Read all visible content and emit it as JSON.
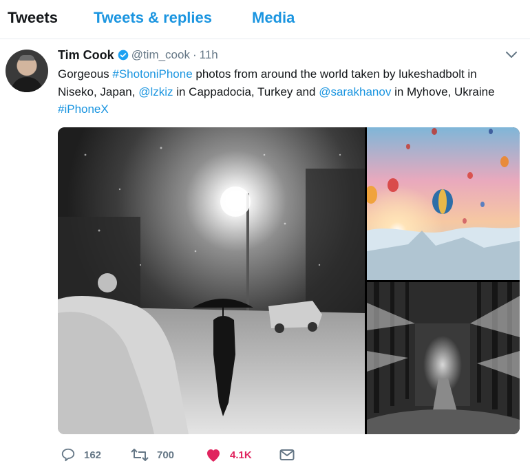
{
  "tabs": [
    "Tweets",
    "Tweets & replies",
    "Media"
  ],
  "tweet": {
    "name": "Tim Cook",
    "handle": "@tim_cook",
    "separator": "·",
    "time": "11h",
    "text_parts": [
      {
        "t": "Gorgeous ",
        "link": false
      },
      {
        "t": "#ShotoniPhone",
        "link": true
      },
      {
        "t": " photos from around the world taken by lukeshadbolt in Niseko, Japan, ",
        "link": false
      },
      {
        "t": "@lzkiz",
        "link": true
      },
      {
        "t": " in Cappadocia, Turkey and ",
        "link": false
      },
      {
        "t": "@sarakhanov",
        "link": true
      },
      {
        "t": " in Myhove, Ukraine ",
        "link": false
      },
      {
        "t": "#iPhoneX",
        "link": true
      }
    ]
  },
  "actions": {
    "replies": "162",
    "retweets": "700",
    "likes": "4.1K"
  },
  "icons": {
    "verified": "verified-badge-icon",
    "caret": "chevron-down-icon",
    "reply": "reply-icon",
    "retweet": "retweet-icon",
    "like": "heart-icon",
    "dm": "envelope-icon"
  },
  "colors": {
    "link": "#1b95e0",
    "muted": "#657786",
    "like": "#e0245e",
    "text": "#14171a"
  }
}
